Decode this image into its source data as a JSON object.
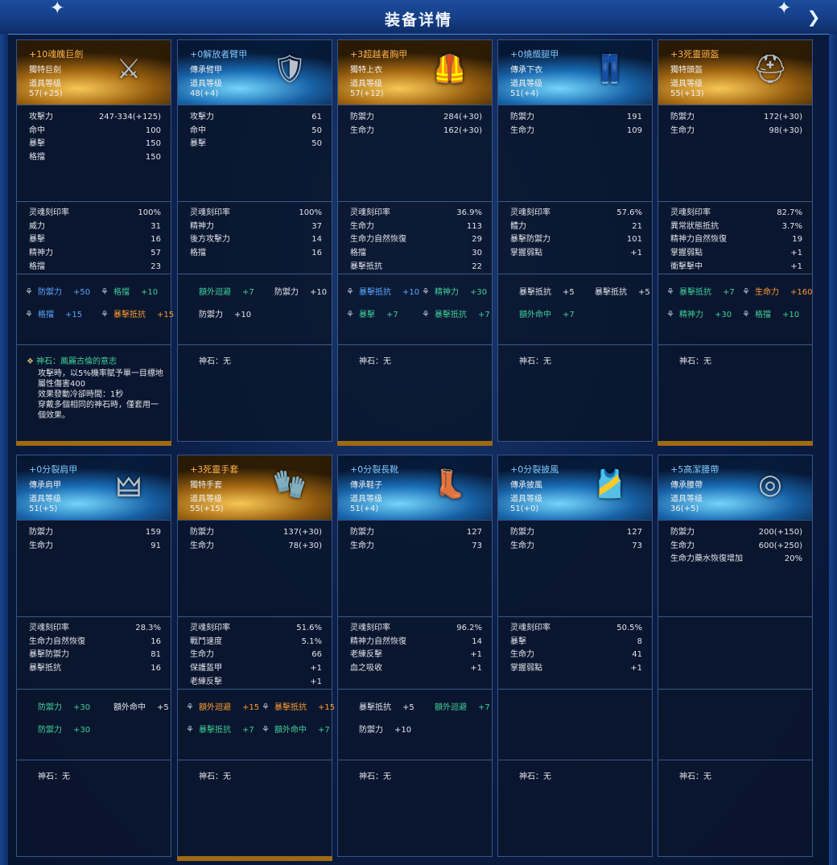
{
  "window": {
    "title": "装备详情"
  },
  "items": [
    {
      "rarity": "gold",
      "name": "+10魂魄巨劍",
      "type": "獨特巨劍",
      "level_label": "道具等级",
      "level": "57(+25)",
      "icon": "greatsword-icon",
      "base_stats": [
        [
          "攻擊力",
          "247-334(+125)"
        ],
        [
          "命中",
          "100"
        ],
        [
          "暴擊",
          "150"
        ],
        [
          "格擋",
          "150"
        ]
      ],
      "soul_stats": [
        [
          "灵魂刻印率",
          "100%"
        ],
        [
          "威力",
          "31"
        ],
        [
          "暴擊",
          "16"
        ],
        [
          "精神力",
          "57"
        ],
        [
          "格擋",
          "23"
        ]
      ],
      "bonuses": [
        {
          "label": "防禦力",
          "value": "+50",
          "color": "blue",
          "gem": true
        },
        {
          "label": "格擋",
          "value": "+10",
          "color": "green",
          "gem": true
        },
        {
          "label": "格擋",
          "value": "+15",
          "color": "blue",
          "gem": true
        },
        {
          "label": "暴擊抵抗",
          "value": "+15",
          "color": "orange",
          "gem": true
        }
      ],
      "stone": {
        "title": "神石：鳳麗古倫的意志",
        "desc": [
          "攻擊時，以5%機率賦予單一目標地",
          "屬性傷害400",
          "效果發動冷卻時間：1秒",
          "穿戴多個相同的神石時，僅套用一",
          "個效果。"
        ]
      }
    },
    {
      "rarity": "blue",
      "name": "+0解放者臂甲",
      "type": "傳承臂甲",
      "level_label": "道具等级",
      "level": "48(+4)",
      "icon": "bracer-icon",
      "base_stats": [
        [
          "攻擊力",
          "61"
        ],
        [
          "命中",
          "50"
        ],
        [
          "暴擊",
          "50"
        ]
      ],
      "soul_stats": [
        [
          "灵魂刻印率",
          "100%"
        ],
        [
          "精神力",
          "37"
        ],
        [
          "後方攻擊力",
          "14"
        ],
        [
          "格擋",
          "16"
        ]
      ],
      "bonuses": [
        {
          "label": "額外迴避",
          "value": "+7",
          "color": "green",
          "gem": false
        },
        {
          "label": "防禦力",
          "value": "+10",
          "color": "white",
          "gem": false
        },
        {
          "label": "防禦力",
          "value": "+10",
          "color": "white",
          "gem": false
        }
      ],
      "stone": {
        "text": "神石：无"
      }
    },
    {
      "rarity": "gold",
      "name": "+3超越者胸甲",
      "type": "獨特上衣",
      "level_label": "道具等级",
      "level": "57(+12)",
      "icon": "chest-armor-icon",
      "base_stats": [
        [
          "防禦力",
          "284(+30)"
        ],
        [
          "生命力",
          "162(+30)"
        ]
      ],
      "soul_stats": [
        [
          "灵魂刻印率",
          "36.9%"
        ],
        [
          "生命力",
          "113"
        ],
        [
          "生命力自然恢復",
          "29"
        ],
        [
          "格擋",
          "30"
        ],
        [
          "暴擊抵抗",
          "22"
        ]
      ],
      "bonuses": [
        {
          "label": "暴擊抵抗",
          "value": "+10",
          "color": "blue",
          "gem": true
        },
        {
          "label": "精神力",
          "value": "+30",
          "color": "green",
          "gem": true
        },
        {
          "label": "暴擊",
          "value": "+7",
          "color": "green",
          "gem": true
        },
        {
          "label": "暴擊抵抗",
          "value": "+7",
          "color": "green",
          "gem": true
        }
      ],
      "stone": {
        "text": "神石：无"
      }
    },
    {
      "rarity": "blue",
      "name": "+0燒燬腿甲",
      "type": "傳承下衣",
      "level_label": "道具等级",
      "level": "51(+4)",
      "icon": "leg-armor-icon",
      "base_stats": [
        [
          "防禦力",
          "191"
        ],
        [
          "生命力",
          "109"
        ]
      ],
      "soul_stats": [
        [
          "灵魂刻印率",
          "57.6%"
        ],
        [
          "體力",
          "21"
        ],
        [
          "暴擊防禦力",
          "101"
        ],
        [
          "掌握弱點",
          "+1"
        ]
      ],
      "bonuses": [
        {
          "label": "暴擊抵抗",
          "value": "+5",
          "color": "white",
          "gem": false
        },
        {
          "label": "暴擊抵抗",
          "value": "+5",
          "color": "white",
          "gem": false
        },
        {
          "label": "額外命中",
          "value": "+7",
          "color": "green",
          "gem": false
        }
      ],
      "stone": {
        "text": "神石：无"
      }
    },
    {
      "rarity": "gold",
      "name": "+3死靈頭盔",
      "type": "獨特頭盔",
      "level_label": "道具等级",
      "level": "55(+13)",
      "icon": "helmet-icon",
      "base_stats": [
        [
          "防禦力",
          "172(+30)"
        ],
        [
          "生命力",
          "98(+30)"
        ]
      ],
      "soul_stats": [
        [
          "灵魂刻印率",
          "82.7%"
        ],
        [
          "異常狀態抵抗",
          "3.7%"
        ],
        [
          "精神力自然恢復",
          "19"
        ],
        [
          "掌握弱點",
          "+1"
        ],
        [
          "衝擊擊中",
          "+1"
        ]
      ],
      "bonuses": [
        {
          "label": "暴擊抵抗",
          "value": "+7",
          "color": "green",
          "gem": true
        },
        {
          "label": "生命力",
          "value": "+160",
          "color": "orange",
          "gem": true
        },
        {
          "label": "精神力",
          "value": "+30",
          "color": "green",
          "gem": true
        },
        {
          "label": "格擋",
          "value": "+10",
          "color": "green",
          "gem": true
        }
      ],
      "stone": {
        "text": "神石：无"
      }
    },
    {
      "rarity": "blue",
      "name": "+0分裂肩甲",
      "type": "傳承肩甲",
      "level_label": "道具等级",
      "level": "51(+5)",
      "icon": "pauldron-icon",
      "base_stats": [
        [
          "防禦力",
          "159"
        ],
        [
          "生命力",
          "91"
        ]
      ],
      "soul_stats": [
        [
          "灵魂刻印率",
          "28.3%"
        ],
        [
          "生命力自然恢復",
          "16"
        ],
        [
          "暴擊防禦力",
          "81"
        ],
        [
          "暴擊抵抗",
          "16"
        ]
      ],
      "bonuses": [
        {
          "label": "防禦力",
          "value": "+30",
          "color": "green",
          "gem": false
        },
        {
          "label": "額外命中",
          "value": "+5",
          "color": "white",
          "gem": false
        },
        {
          "label": "防禦力",
          "value": "+30",
          "color": "green",
          "gem": false
        }
      ],
      "stone": {
        "text": "神石：无"
      }
    },
    {
      "rarity": "gold",
      "name": "+3死靈手套",
      "type": "獨特手套",
      "level_label": "道具等级",
      "level": "55(+15)",
      "icon": "gauntlet-icon",
      "base_stats": [
        [
          "防禦力",
          "137(+30)"
        ],
        [
          "生命力",
          "78(+30)"
        ]
      ],
      "soul_stats": [
        [
          "灵魂刻印率",
          "51.6%"
        ],
        [
          "戰鬥速度",
          "5.1%"
        ],
        [
          "生命力",
          "66"
        ],
        [
          "保護盔甲",
          "+1"
        ],
        [
          "老練反擊",
          "+1"
        ]
      ],
      "bonuses": [
        {
          "label": "額外迴避",
          "value": "+15",
          "color": "orange",
          "gem": true
        },
        {
          "label": "暴擊抵抗",
          "value": "+15",
          "color": "orange",
          "gem": true
        },
        {
          "label": "暴擊抵抗",
          "value": "+7",
          "color": "green",
          "gem": true
        },
        {
          "label": "額外命中",
          "value": "+7",
          "color": "green",
          "gem": true
        }
      ],
      "stone": {
        "text": "神石：无"
      }
    },
    {
      "rarity": "blue",
      "name": "+0分裂長靴",
      "type": "傳承鞋子",
      "level_label": "道具等级",
      "level": "51(+4)",
      "icon": "boots-icon",
      "base_stats": [
        [
          "防禦力",
          "127"
        ],
        [
          "生命力",
          "73"
        ]
      ],
      "soul_stats": [
        [
          "灵魂刻印率",
          "96.2%"
        ],
        [
          "精神力自然恢復",
          "14"
        ],
        [
          "老練反擊",
          "+1"
        ],
        [
          "血之吸收",
          "+1"
        ]
      ],
      "bonuses": [
        {
          "label": "暴擊抵抗",
          "value": "+5",
          "color": "white",
          "gem": false
        },
        {
          "label": "額外迴避",
          "value": "+7",
          "color": "green",
          "gem": false
        },
        {
          "label": "防禦力",
          "value": "+10",
          "color": "white",
          "gem": false
        }
      ],
      "stone": {
        "text": "神石：无"
      }
    },
    {
      "rarity": "blue",
      "name": "+0分裂披風",
      "type": "傳承披風",
      "level_label": "道具等级",
      "level": "51(+0)",
      "icon": "cape-icon",
      "base_stats": [
        [
          "防禦力",
          "127"
        ],
        [
          "生命力",
          "73"
        ]
      ],
      "soul_stats": [
        [
          "灵魂刻印率",
          "50.5%"
        ],
        [
          "暴擊",
          "8"
        ],
        [
          "生命力",
          "41"
        ],
        [
          "掌握弱點",
          "+1"
        ]
      ],
      "bonuses": [],
      "stone": {
        "text": "神石：无"
      }
    },
    {
      "rarity": "blue",
      "name": "+5高潔腰帶",
      "type": "傳承腰帶",
      "level_label": "道具等级",
      "level": "36(+5)",
      "icon": "belt-icon",
      "base_stats": [
        [
          "防禦力",
          "200(+150)"
        ],
        [
          "生命力",
          "600(+250)"
        ],
        [
          "生命力藥水恢復增加",
          "20%"
        ]
      ],
      "soul_stats": [],
      "bonuses": [],
      "stone": {
        "text": "神石：无"
      }
    }
  ]
}
